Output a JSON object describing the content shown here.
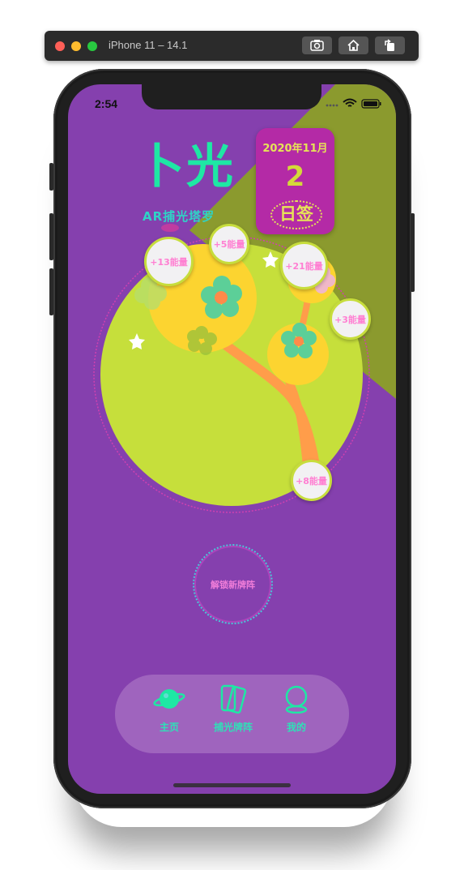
{
  "simulator": {
    "title": "iPhone 11 – 14.1",
    "toolbar_icons": [
      "screenshot-icon",
      "home-icon",
      "rotate-icon"
    ]
  },
  "status_bar": {
    "time": "2:54"
  },
  "logo": {
    "title": "卜光",
    "subtitle": "AR捕光塔罗"
  },
  "date_card": {
    "month": "2020年11月",
    "day": "2",
    "sign_label": "日签"
  },
  "energy_bubbles": [
    {
      "label": "+13能量"
    },
    {
      "label": "+5能量"
    },
    {
      "label": "+21能量"
    },
    {
      "label": "+3能量"
    },
    {
      "label": "+8能量"
    }
  ],
  "unlock_button": {
    "label": "解锁新牌阵"
  },
  "tabbar": {
    "items": [
      {
        "label": "主页",
        "icon": "planet-icon"
      },
      {
        "label": "捕光牌阵",
        "icon": "cards-icon"
      },
      {
        "label": "我的",
        "icon": "crystal-ball-icon"
      }
    ]
  },
  "colors": {
    "background": "#8540ae",
    "olive_band": "#8b9a2e",
    "circle": "#c6df3b",
    "accent_green": "#1ee8a4",
    "date_card": "#b42aa6",
    "energy_text": "#ff7fd2"
  }
}
